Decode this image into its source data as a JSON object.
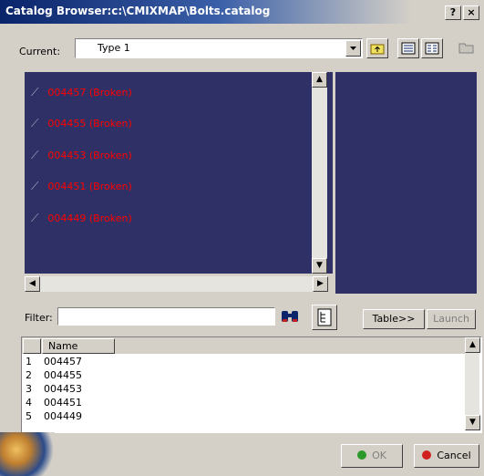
{
  "window": {
    "title": "Catalog Browser:c:\\CMIXMAP\\Bolts.catalog",
    "help_label": "?",
    "close_label": "×"
  },
  "current": {
    "label": "Current:",
    "value": "Type 1"
  },
  "tree": {
    "items": [
      {
        "label": "004457 (Broken)"
      },
      {
        "label": "004455 (Broken)"
      },
      {
        "label": "004453 (Broken)"
      },
      {
        "label": "004451 (Broken)"
      },
      {
        "label": "004449 (Broken)"
      }
    ]
  },
  "filter": {
    "label": "Filter:",
    "value": ""
  },
  "buttons": {
    "table": "Table>>",
    "launch": "Launch",
    "ok": "OK",
    "cancel": "Cancel"
  },
  "table": {
    "column_name": "Name",
    "rows": [
      {
        "index": "1",
        "name": "004457"
      },
      {
        "index": "2",
        "name": "004455"
      },
      {
        "index": "3",
        "name": "004453"
      },
      {
        "index": "4",
        "name": "004451"
      },
      {
        "index": "5",
        "name": "004449"
      }
    ]
  },
  "icons": {
    "find": "binoculars-icon",
    "tree_view": "tree-view-icon",
    "up_folder": "up-folder-icon",
    "details_view": "details-view-icon",
    "list_view": "list-view-icon",
    "open_folder": "open-folder-icon"
  },
  "colors": {
    "title_bar": "#0a246a",
    "panel_bg": "#2f3166",
    "broken_text": "#ff0000",
    "ok_dot": "#2a9a2a",
    "cancel_dot": "#d02020"
  }
}
